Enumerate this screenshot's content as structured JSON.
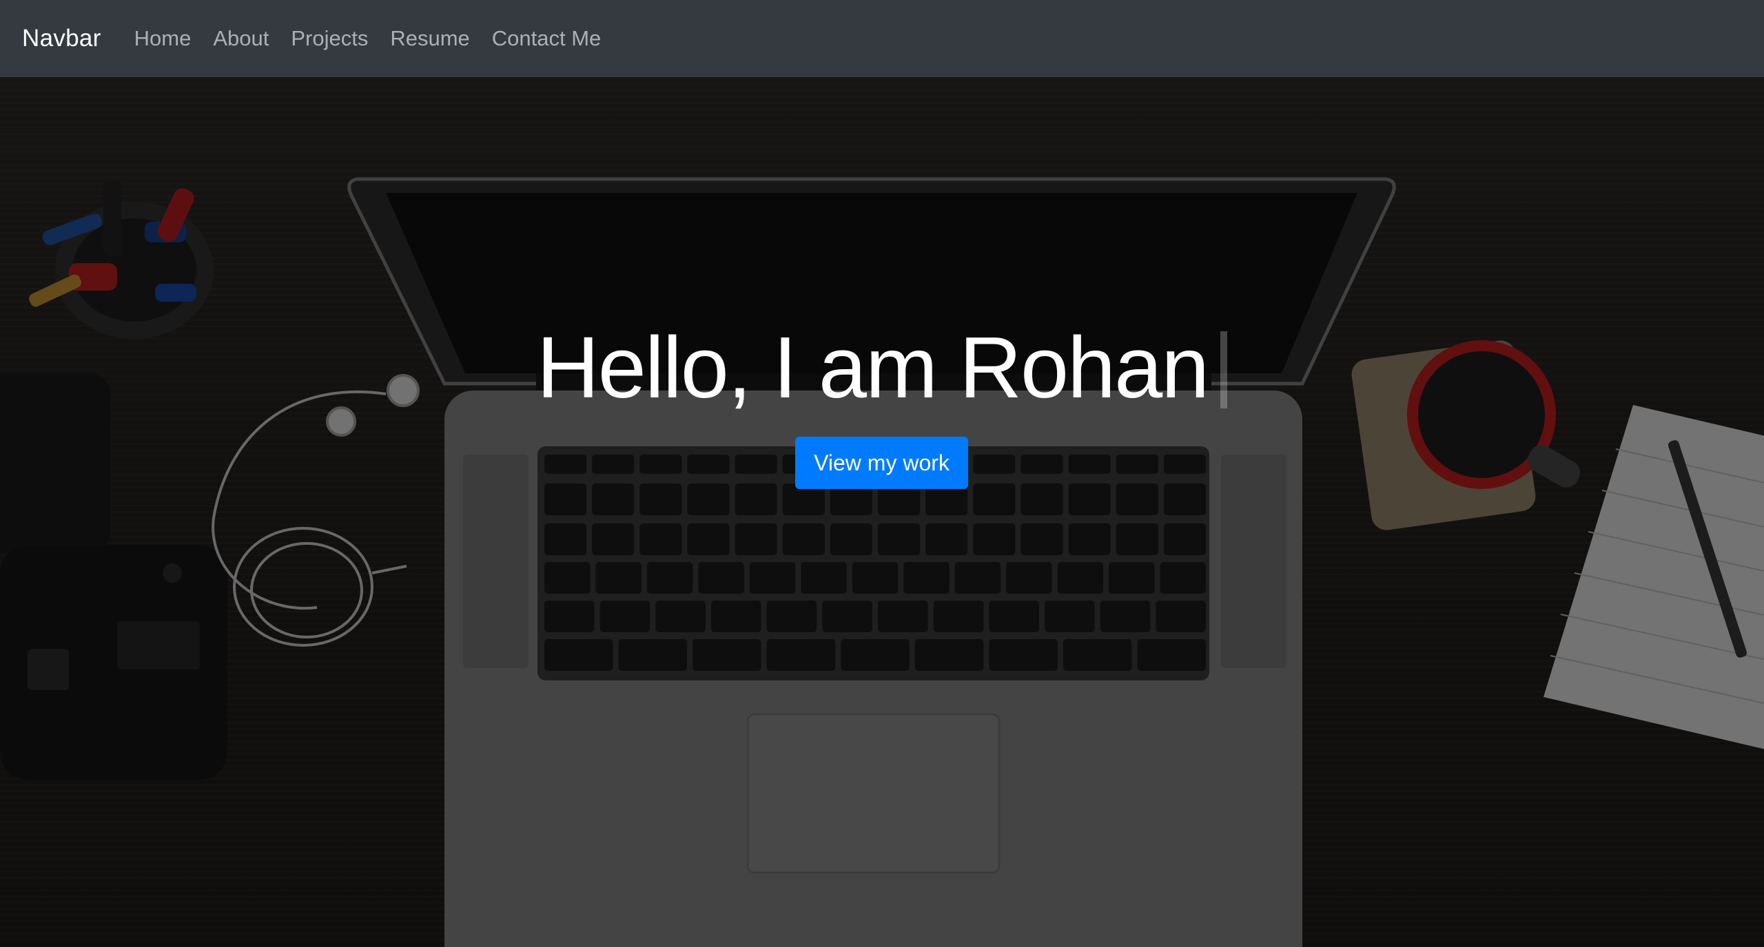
{
  "navbar": {
    "brand": "Navbar",
    "links": [
      {
        "label": "Home"
      },
      {
        "label": "About"
      },
      {
        "label": "Projects"
      },
      {
        "label": "Resume"
      },
      {
        "label": "Contact Me"
      }
    ]
  },
  "hero": {
    "title": "Hello, I am Rohan",
    "cta_label": "View my work",
    "background_description_icon": "desk-with-laptop-image"
  },
  "colors": {
    "navbar_bg": "#343a40",
    "cta_bg": "#007bff",
    "text": "#ffffff"
  }
}
